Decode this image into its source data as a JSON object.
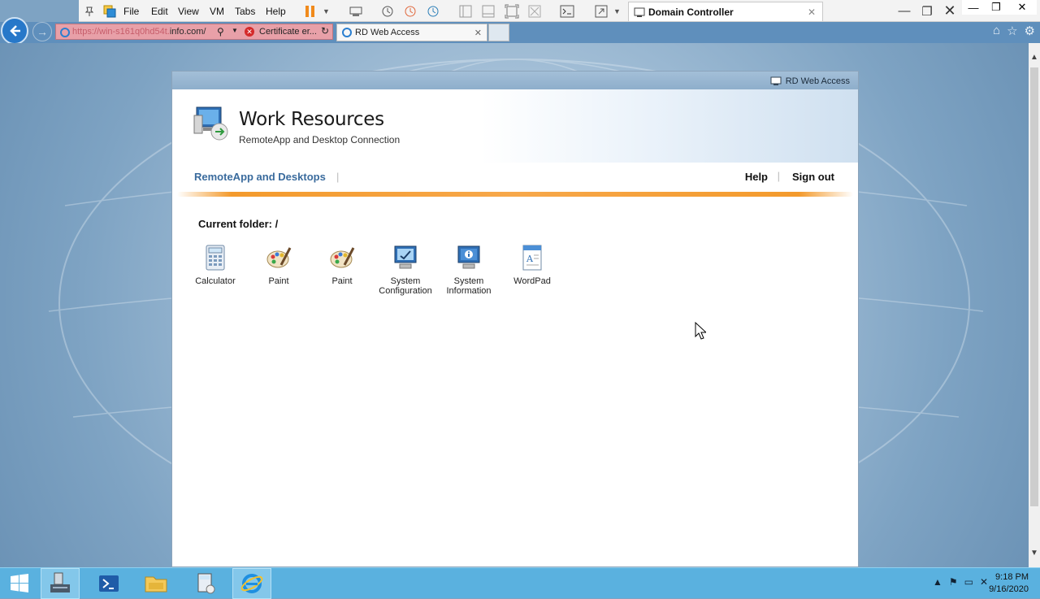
{
  "vmware": {
    "menus": [
      "File",
      "Edit",
      "View",
      "VM",
      "Tabs",
      "Help"
    ],
    "tab_title": "Domain Controller"
  },
  "browser": {
    "url_prefix": "https://win-s161q0hd54t.",
    "url_domain": "info.com/",
    "cert_text": "Certificate er...",
    "tab_title": "RD Web Access"
  },
  "rdweb": {
    "header_label": "RD Web Access",
    "title": "Work Resources",
    "subtitle": "RemoteApp and Desktop Connection",
    "nav_left": "RemoteApp and Desktops",
    "help": "Help",
    "sign_out": "Sign out",
    "current_folder": "Current folder: /",
    "apps": [
      {
        "label": "Calculator",
        "icon": "calculator-icon"
      },
      {
        "label": "Paint",
        "icon": "paint-icon"
      },
      {
        "label": "Paint",
        "icon": "paint-icon"
      },
      {
        "label": "System\nConfiguration",
        "icon": "system-configuration-icon"
      },
      {
        "label": "System\nInformation",
        "icon": "system-information-icon"
      },
      {
        "label": "WordPad",
        "icon": "wordpad-icon"
      }
    ]
  },
  "taskbar": {
    "time": "9:18 PM",
    "date": "9/16/2020"
  },
  "colors": {
    "accent": "#3a6b9d",
    "orange_bar": "#f39a2c",
    "taskbar": "#5ab1df"
  }
}
